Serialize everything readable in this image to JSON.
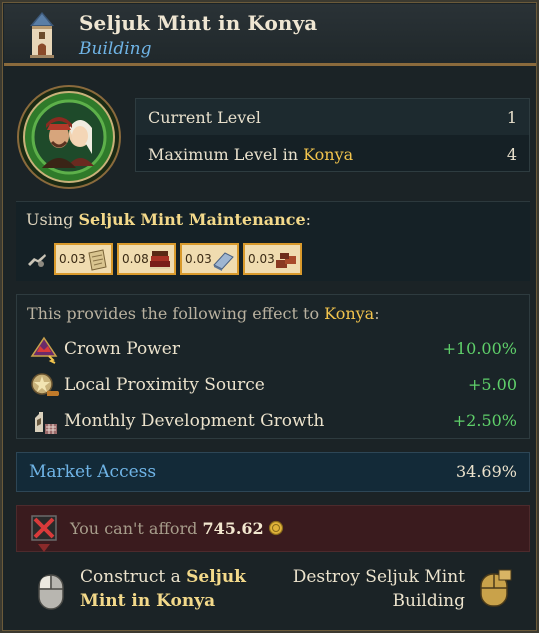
{
  "header": {
    "title": "Seljuk Mint in Konya",
    "subtitle": "Building"
  },
  "levels": {
    "current_label": "Current Level",
    "current_value": "1",
    "max_label_prefix": "Maximum Level in ",
    "max_label_location": "Konya",
    "max_value": "4"
  },
  "maintenance": {
    "prefix": "Using ",
    "name": "Seljuk Mint Maintenance",
    "suffix": ":",
    "goods": [
      {
        "amount": "0.03",
        "icon": "paper-goods-icon"
      },
      {
        "amount": "0.08",
        "icon": "books-goods-icon"
      },
      {
        "amount": "0.03",
        "icon": "silver-goods-icon"
      },
      {
        "amount": "0.03",
        "icon": "copper-goods-icon"
      }
    ]
  },
  "effects": {
    "title_prefix": "This provides the following effect to ",
    "title_location": "Konya",
    "title_suffix": ":",
    "rows": [
      {
        "label": "Crown Power",
        "value": "+10.00%",
        "icon": "crown-power-icon"
      },
      {
        "label": "Local Proximity Source",
        "value": "+5.00",
        "icon": "proximity-source-icon"
      },
      {
        "label": "Monthly Development Growth",
        "value": "+2.50%",
        "icon": "development-growth-icon"
      }
    ]
  },
  "market": {
    "label": "Market Access",
    "value": "34.69%"
  },
  "afford": {
    "text": "You can't afford ",
    "amount": "745.62"
  },
  "actions": {
    "construct_prefix": "Construct a ",
    "construct_name_1": "Seljuk",
    "construct_name_2": "Mint in Konya",
    "destroy_line1": "Destroy Seljuk Mint",
    "destroy_line2": "Building"
  },
  "colors": {
    "accent_blue": "#6fb4e6",
    "highlight_gold": "#f2c44d",
    "positive_green": "#5fd06a",
    "warning_bg": "#3a1b1e"
  }
}
